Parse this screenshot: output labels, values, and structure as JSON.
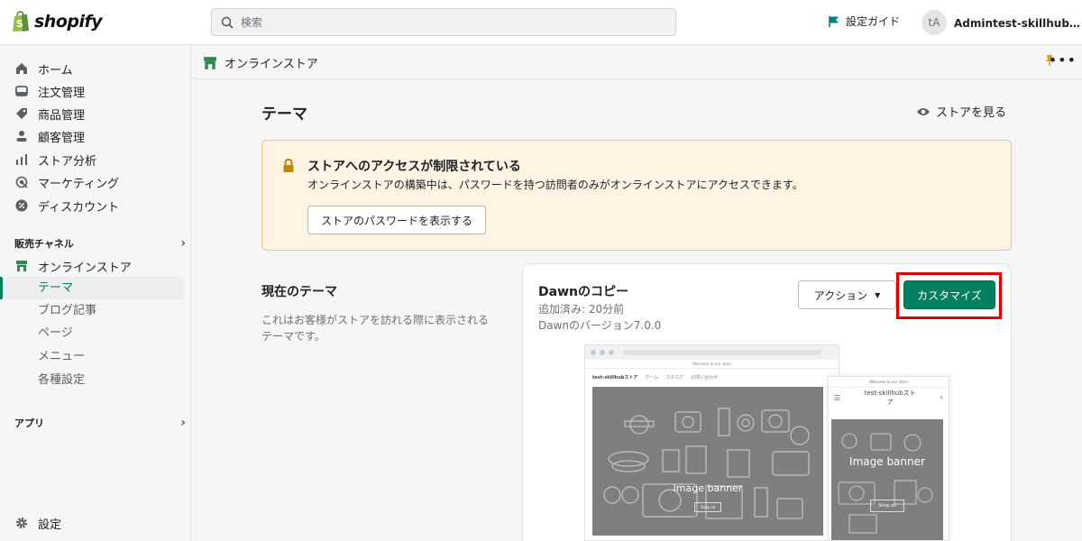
{
  "brand": {
    "logo_text": "shopify",
    "accent": "#008060"
  },
  "topbar": {
    "search_placeholder": "検索",
    "setup_guide": "設定ガイド",
    "avatar_initials": "tA",
    "account_name": "Admintest-skillhubスト..."
  },
  "sidebar": {
    "items": [
      {
        "label": "ホーム",
        "icon": "home-icon"
      },
      {
        "label": "注文管理",
        "icon": "orders-icon"
      },
      {
        "label": "商品管理",
        "icon": "tag-icon"
      },
      {
        "label": "顧客管理",
        "icon": "person-icon"
      },
      {
        "label": "ストア分析",
        "icon": "analytics-icon"
      },
      {
        "label": "マーケティング",
        "icon": "target-icon"
      },
      {
        "label": "ディスカウント",
        "icon": "discount-icon"
      }
    ],
    "sales_channels_heading": "販売チャネル",
    "online_store": "オンラインストア",
    "online_store_subitems": [
      "テーマ",
      "ブログ記事",
      "ページ",
      "メニュー",
      "各種設定"
    ],
    "apps_heading": "アプリ",
    "settings": "設定"
  },
  "subheader": {
    "title": "オンラインストア"
  },
  "main": {
    "page_title": "テーマ",
    "view_store": "ストアを見る",
    "banner": {
      "title": "ストアへのアクセスが制限されている",
      "text": "オンラインストアの構築中は、パスワードを持つ訪問者のみがオンラインストアにアクセスできます。",
      "button": "ストアのパスワードを表示する"
    },
    "current_theme": {
      "heading": "現在のテーマ",
      "description": "これはお客様がストアを訪れる際に表示されるテーマです。"
    },
    "theme_card": {
      "name": "Dawnのコピー",
      "added": "追加済み: 20分前",
      "version": "Dawnのバージョン7.0.0",
      "actions_button": "アクション",
      "customize_button": "カスタマイズ"
    }
  },
  "preview": {
    "desktop_announcement": "Welcome to our store",
    "desktop_store_name": "test-skillhubストア",
    "desktop_nav": [
      "ホーム",
      "カタログ",
      "お問い合わせ"
    ],
    "desktop_banner": "Image banner",
    "desktop_button": "Shop all",
    "mobile_announcement": "Welcome to our store",
    "mobile_store_name": "test-skillhubストア",
    "mobile_banner": "Image banner",
    "mobile_button": "Shop all"
  }
}
